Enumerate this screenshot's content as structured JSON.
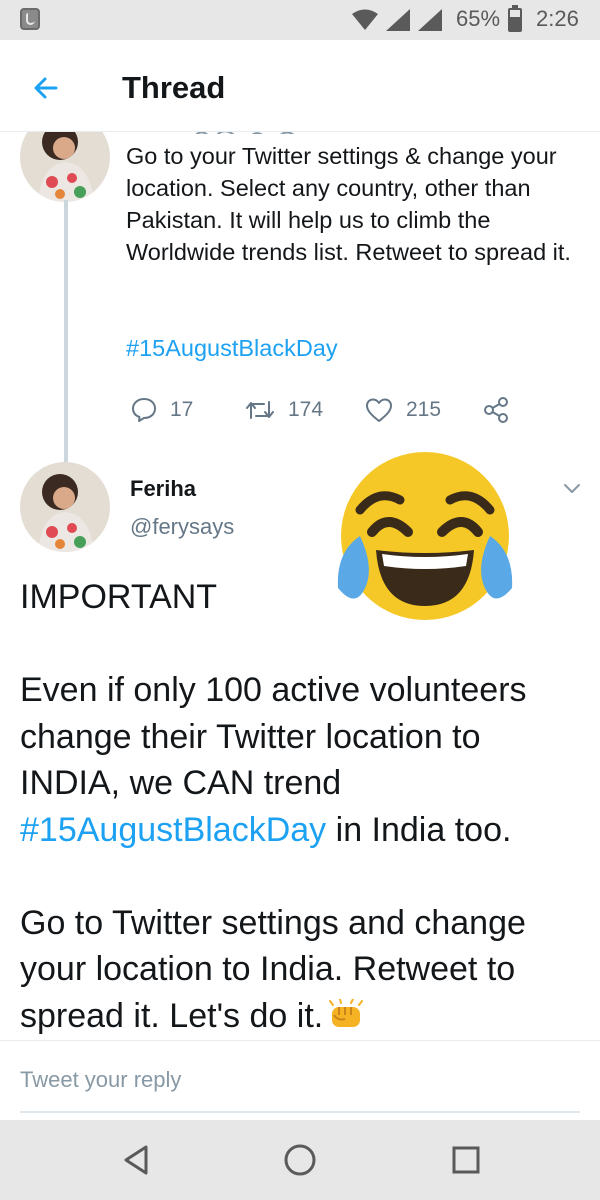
{
  "status_bar": {
    "battery_percent": "65%",
    "time": "2:26",
    "icons": [
      "app-notification-icon",
      "wifi-icon",
      "signal-icon",
      "signal-icon",
      "battery-icon"
    ]
  },
  "header": {
    "title": "Thread",
    "back_icon": "arrow-left-icon"
  },
  "tweet1": {
    "text": "Go to your Twitter settings & change your location. Select any country, other than Pakistan. It will help us to climb the Worldwide trends list. Retweet to spread it.",
    "hashtag": "#15AugustBlackDay",
    "replies": "17",
    "retweets": "174",
    "likes": "215"
  },
  "tweet2": {
    "name": "Feriha",
    "handle": "@ferysays",
    "para1": "IMPORTANT",
    "para2_before": "Even if only 100 active volunteers change their Twitter location to INDIA, we CAN trend ",
    "hashtag": "#15AugustBlackDay",
    "para2_after": " in India too.",
    "para3": "Go to Twitter settings and change your location to India. Retweet to spread it. Let's do it."
  },
  "reply": {
    "placeholder": "Tweet your reply"
  },
  "colors": {
    "accent": "#1da1f2",
    "text": "#14171a",
    "secondary": "#657786",
    "emoji_face": "#f5c827",
    "emoji_tears": "#5aa8e6"
  }
}
